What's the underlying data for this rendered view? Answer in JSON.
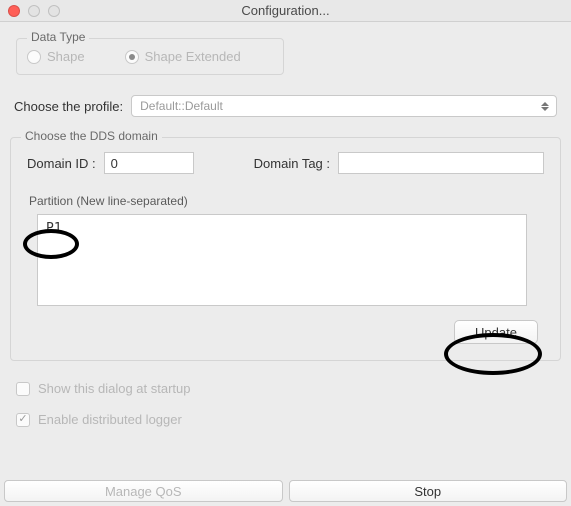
{
  "window": {
    "title": "Configuration..."
  },
  "datatype": {
    "group_label": "Data Type",
    "options": [
      {
        "label": "Shape",
        "selected": false
      },
      {
        "label": "Shape Extended",
        "selected": true
      }
    ]
  },
  "profile": {
    "label": "Choose the profile:",
    "selected": "Default::Default"
  },
  "dds": {
    "group_label": "Choose the DDS domain",
    "domain_id_label": "Domain ID :",
    "domain_id_value": "0",
    "domain_tag_label": "Domain Tag :",
    "domain_tag_value": "",
    "partition_label": "Partition (New line-separated)",
    "partition_value": "P1",
    "update_label": "Update"
  },
  "checks": {
    "show_startup": "Show this dialog at startup",
    "enable_logger": "Enable distributed logger",
    "show_startup_checked": false,
    "enable_logger_checked": true
  },
  "bottom": {
    "manage_qos": "Manage QoS",
    "stop": "Stop"
  }
}
